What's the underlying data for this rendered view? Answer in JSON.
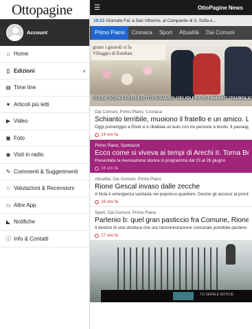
{
  "sidebar": {
    "logo": "Ottopagine",
    "account_label": "Account",
    "items": [
      {
        "label": "Home",
        "icon": "home-icon",
        "glyph": "⌂"
      },
      {
        "label": "Edizioni",
        "icon": "book-icon",
        "glyph": "▯",
        "active": true
      },
      {
        "label": "Time line",
        "icon": "timeline-icon",
        "glyph": "▤"
      },
      {
        "label": "Articoli più letti",
        "icon": "heart-icon",
        "glyph": "♥"
      },
      {
        "label": "Video",
        "icon": "play-icon",
        "glyph": "▶"
      },
      {
        "label": "Foto",
        "icon": "photo-icon",
        "glyph": "▣"
      },
      {
        "label": "Visti in radio",
        "icon": "radio-icon",
        "glyph": "◉"
      },
      {
        "label": "Commenti & Suggerimenti",
        "icon": "comment-icon",
        "glyph": "✎"
      },
      {
        "label": "Valutazioni & Recensioni",
        "icon": "star-icon",
        "glyph": "☆"
      },
      {
        "label": "Altre App",
        "icon": "monitor-icon",
        "glyph": "▭"
      },
      {
        "label": "Notifiche",
        "icon": "megaphone-icon",
        "glyph": "◣"
      },
      {
        "label": "Info & Contatti",
        "icon": "info-icon",
        "glyph": "ⓘ"
      }
    ]
  },
  "topbar": {
    "title": "OttoPagine News"
  },
  "ticker": {
    "time": "19:53",
    "text": "Giornate Fai: a San Vittorino, al Campanile di S. Sofia e..."
  },
  "tabs": [
    "Primo Piano",
    "Cronaca",
    "Sport",
    "Attualità",
    "Dai Comuni"
  ],
  "hero": {
    "sign_line1": "girare i girasoli si fa",
    "sign_line2": "Villaggio di Esteban.",
    "caption": "SULLA SCENA DEL DELITTO SGUARDI GELIDI FRA GLI AMANTI \"DIABOLICI\""
  },
  "articles": [
    {
      "category": "Dai Comuni, Primo Piano, Cronaca",
      "headline": "Schianto terribile, muoiono il fratello e un amico. Lui te",
      "excerpt": "Oggi pomeriggio a Eboli si è ribaltata un'auto con tre persone a bordo. Il passeggero",
      "time": "14 ore fa",
      "featured": false
    },
    {
      "category": "Primo Piano, Spettacoli",
      "headline": "Ecco come si viveva ai tempi di Arechi II. Torna Benever",
      "excerpt": "Presentata la rievocazione storica in programma dal 23 al 26 giugno",
      "time": "16 ore fa",
      "featured": true
    },
    {
      "category": "Attualità, Dai Comuni, Primo Piano",
      "headline": "Rione Gescal invaso dalle zecche",
      "excerpt": "A Nola è emergenza sanitaria nel popoloso quartiere. Decine gli accessi al pronto soc",
      "time": "16 ore fa",
      "featured": false
    },
    {
      "category": "Sport, Dai Comuni, Primo Piano",
      "headline": "Partenio b: quel gran pasticcio fra Comune, Rione Mazz",
      "excerpt": "Il destino di una struttura che ora l'amministrazione comunale potrebbe perdere. Ecco",
      "time": "17 ore fa",
      "featured": false
    }
  ],
  "photo2": {
    "overlay_text": "TG SERALE NOTIZIE"
  },
  "colors": {
    "accent": "#1f66d0",
    "featured": "#a0257b",
    "time": "#d42b2b",
    "topbar": "#1a1a1a"
  }
}
